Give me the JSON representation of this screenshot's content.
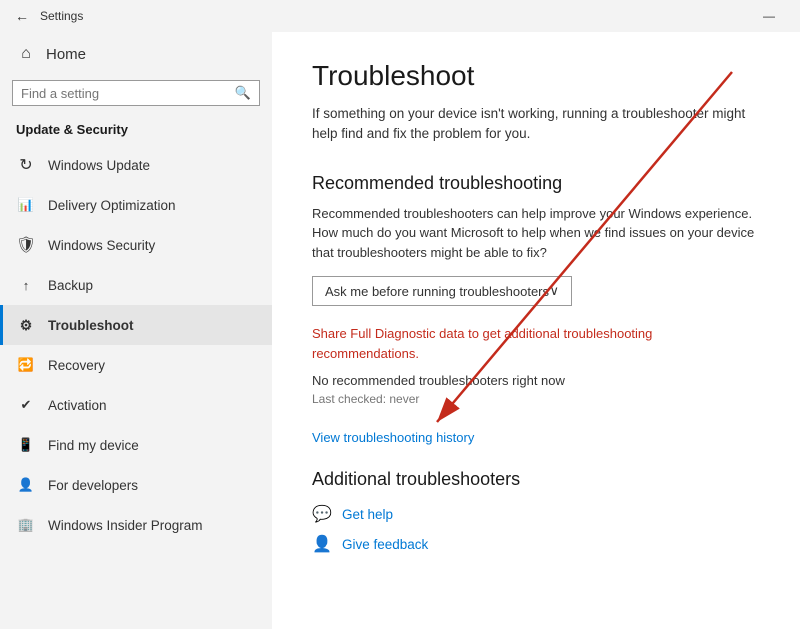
{
  "titlebar": {
    "back_icon": "←",
    "title": "Settings",
    "minimize_label": "—"
  },
  "sidebar": {
    "home_label": "Home",
    "search_placeholder": "Find a setting",
    "search_icon": "🔍",
    "section_title": "Update & Security",
    "items": [
      {
        "id": "windows-update",
        "label": "Windows Update",
        "icon": "🔄",
        "active": false
      },
      {
        "id": "delivery-optimization",
        "label": "Delivery Optimization",
        "icon": "📥",
        "active": false
      },
      {
        "id": "windows-security",
        "label": "Windows Security",
        "icon": "🛡",
        "active": false
      },
      {
        "id": "backup",
        "label": "Backup",
        "icon": "☁",
        "active": false
      },
      {
        "id": "troubleshoot",
        "label": "Troubleshoot",
        "icon": "🔧",
        "active": true
      },
      {
        "id": "recovery",
        "label": "Recovery",
        "icon": "🔃",
        "active": false
      },
      {
        "id": "activation",
        "label": "Activation",
        "icon": "✔",
        "active": false
      },
      {
        "id": "find-my-device",
        "label": "Find my device",
        "icon": "📍",
        "active": false
      },
      {
        "id": "for-developers",
        "label": "For developers",
        "icon": "💻",
        "active": false
      },
      {
        "id": "windows-insider",
        "label": "Windows Insider Program",
        "icon": "🏢",
        "active": false
      }
    ]
  },
  "main": {
    "page_title": "Troubleshoot",
    "page_subtitle": "If something on your device isn't working, running a troubleshooter might help find and fix the problem for you.",
    "recommended_section_title": "Recommended troubleshooting",
    "recommended_desc": "Recommended troubleshooters can help improve your Windows experience. How much do you want Microsoft to help when we find issues on your device that troubleshooters might be able to fix?",
    "dropdown_value": "Ask me before running troubleshooters",
    "dropdown_icon": "∨",
    "share_link": "Share Full Diagnostic data to get additional troubleshooting recommendations.",
    "no_troubleshooters": "No recommended troubleshooters right now",
    "last_checked": "Last checked: never",
    "view_history_link": "View troubleshooting history",
    "additional_section_title": "Additional troubleshooters",
    "get_help_label": "Get help",
    "give_feedback_label": "Give feedback",
    "get_help_icon": "💬",
    "give_feedback_icon": "👤"
  }
}
